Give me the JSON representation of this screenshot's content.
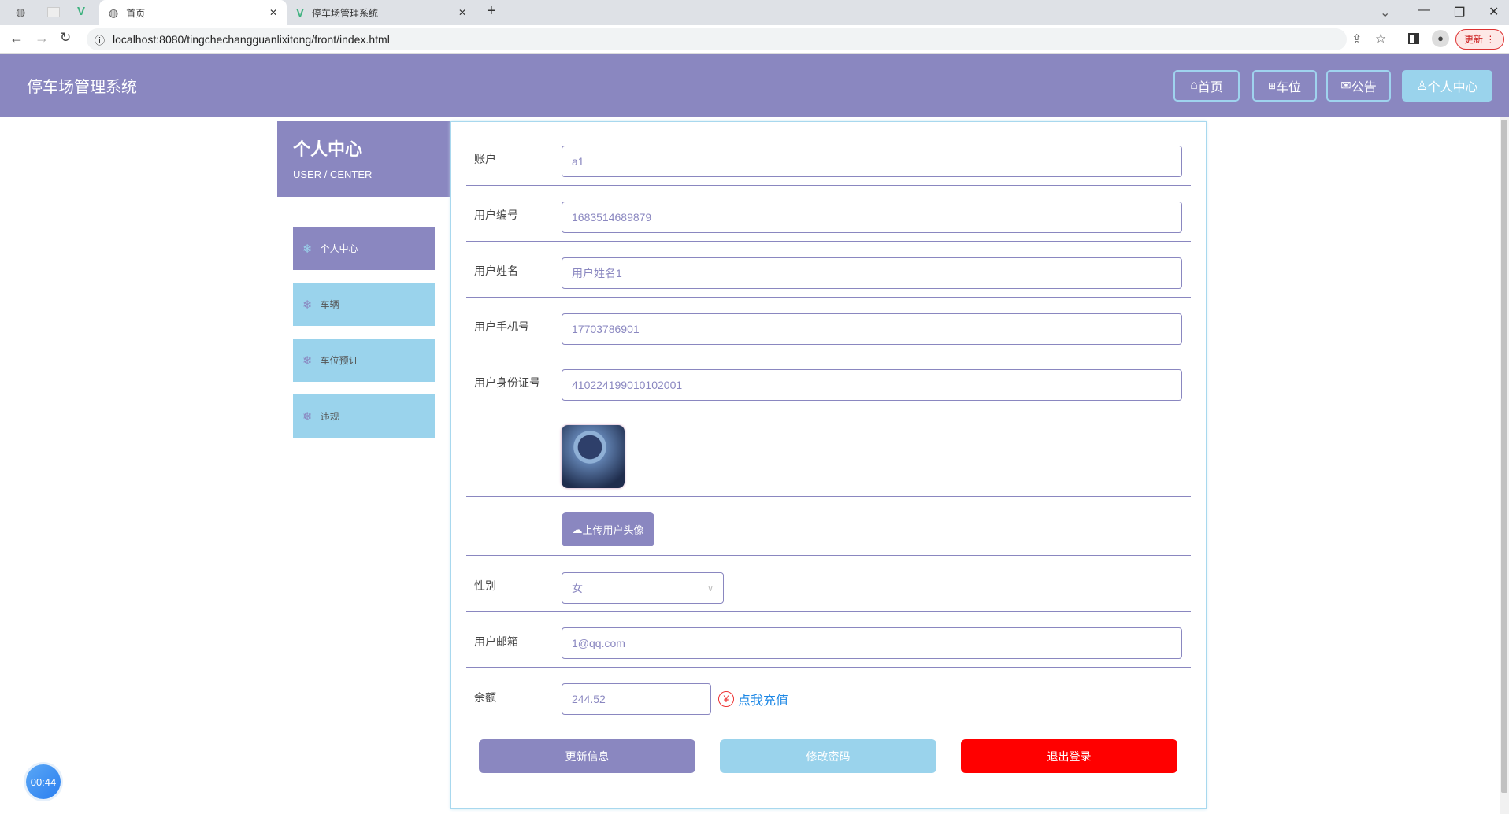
{
  "browser": {
    "tabs": [
      {
        "label": "首页"
      },
      {
        "label": "停车场管理系统"
      }
    ],
    "url": "localhost:8080/tingchechangguanlixitong/front/index.html",
    "update_label": "更新"
  },
  "header": {
    "title": "停车场管理系统",
    "nav": [
      {
        "label": "首页",
        "icon": "home-icon"
      },
      {
        "label": "车位",
        "icon": "gift-icon"
      },
      {
        "label": "公告",
        "icon": "mail-icon"
      },
      {
        "label": "个人中心",
        "icon": "user-icon"
      }
    ]
  },
  "sidebar": {
    "title": "个人中心",
    "subtitle": "USER / CENTER",
    "items": [
      {
        "label": "个人中心"
      },
      {
        "label": "车辆"
      },
      {
        "label": "车位预订"
      },
      {
        "label": "违规"
      }
    ]
  },
  "form": {
    "account": {
      "label": "账户",
      "value": "a1"
    },
    "user_no": {
      "label": "用户编号",
      "value": "1683514689879"
    },
    "name": {
      "label": "用户姓名",
      "value": "用户姓名1"
    },
    "phone": {
      "label": "用户手机号",
      "value": "17703786901"
    },
    "id_card": {
      "label": "用户身份证号",
      "value": "410224199010102001"
    },
    "upload_label": "上传用户头像",
    "gender": {
      "label": "性别",
      "value": "女"
    },
    "email": {
      "label": "用户邮箱",
      "value": "1@qq.com"
    },
    "balance": {
      "label": "余额",
      "value": "244.52",
      "recharge": "点我充值"
    },
    "buttons": {
      "update": "更新信息",
      "password": "修改密码",
      "logout": "退出登录"
    }
  },
  "timer": "00:44",
  "colors": {
    "primary": "#8a87c0",
    "secondary": "#9ad3ec",
    "danger": "#ff0000"
  }
}
